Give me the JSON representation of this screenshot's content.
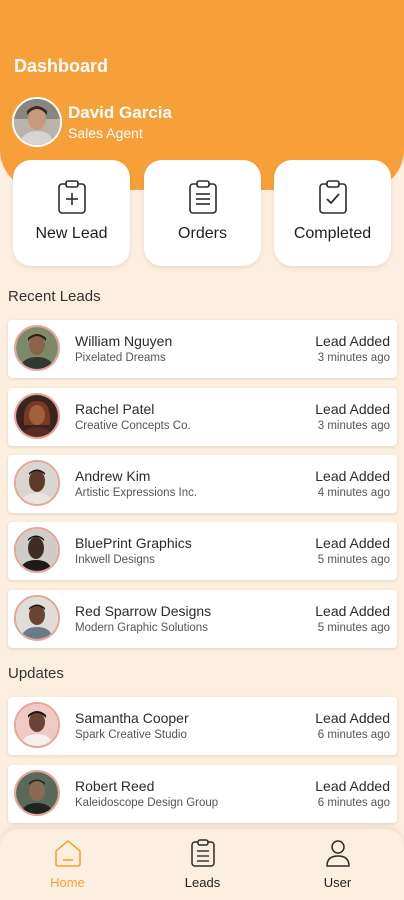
{
  "header": {
    "title": "Dashboard",
    "user_name": "David Garcia",
    "user_role": "Sales Agent",
    "accent": "#f7a03a"
  },
  "actions": [
    {
      "label": "New Lead",
      "icon": "clipboard-plus-icon"
    },
    {
      "label": "Orders",
      "icon": "clipboard-list-icon"
    },
    {
      "label": "Completed",
      "icon": "clipboard-check-icon"
    }
  ],
  "recent": {
    "title": "Recent Leads",
    "items": [
      {
        "name": "William Nguyen",
        "company": "Pixelated Dreams",
        "status": "Lead Added",
        "time": "3 minutes ago",
        "skin": "#8a6448"
      },
      {
        "name": "Rachel Patel",
        "company": "Creative Concepts Co.",
        "status": "Lead Added",
        "time": "3 minutes ago",
        "skin": "#a0603e"
      },
      {
        "name": "Andrew Kim",
        "company": "Artistic Expressions Inc.",
        "status": "Lead Added",
        "time": "4 minutes ago",
        "skin": "#5a3b2a"
      },
      {
        "name": "BluePrint Graphics",
        "company": "Inkwell Designs",
        "status": "Lead Added",
        "time": "5 minutes ago",
        "skin": "#3e2d24"
      },
      {
        "name": "Red Sparrow Designs",
        "company": "Modern Graphic Solutions",
        "status": "Lead Added",
        "time": "5 minutes ago",
        "skin": "#6b4532"
      }
    ]
  },
  "updates": {
    "title": "Updates",
    "items": [
      {
        "name": "Samantha Cooper",
        "company": "Spark Creative Studio",
        "status": "Lead Added",
        "time": "6 minutes ago",
        "skin": "#6a4434"
      },
      {
        "name": "Robert Reed",
        "company": "Kaleidoscope Design Group",
        "status": "Lead Added",
        "time": "6 minutes ago",
        "skin": "#8a6a52"
      }
    ]
  },
  "nav": [
    {
      "label": "Home",
      "icon": "home-icon",
      "active": true
    },
    {
      "label": "Leads",
      "icon": "leads-clipboard-icon",
      "active": false
    },
    {
      "label": "User",
      "icon": "user-icon",
      "active": false
    }
  ]
}
